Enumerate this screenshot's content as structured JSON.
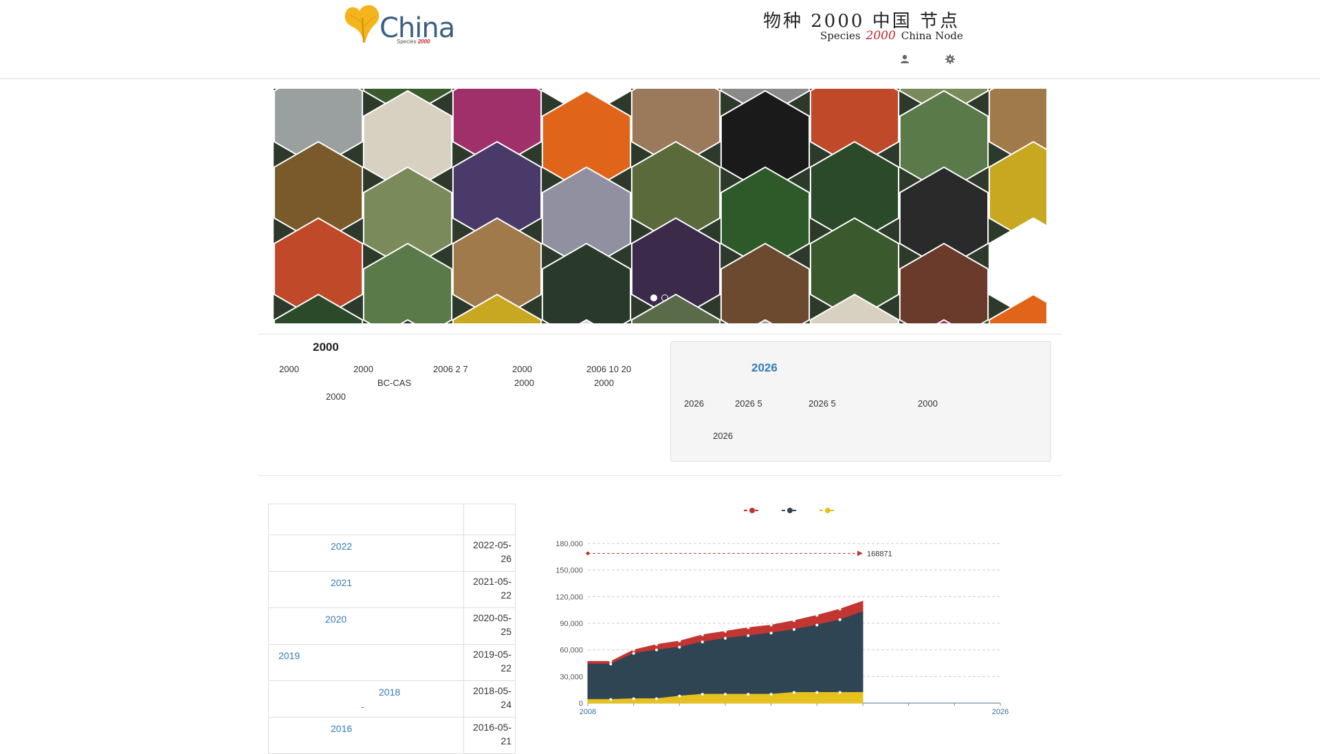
{
  "header": {
    "logo_word": "China",
    "logo_sub_prefix": "Species",
    "logo_sub_mark": "2000",
    "title": "物种 2000 中国 节点",
    "subtitle_left": "Species",
    "subtitle_mark": "2000",
    "subtitle_right": "China Node",
    "icons": [
      "user-icon",
      "gear-icon"
    ]
  },
  "banner": {
    "slide_count": 2,
    "active_slide": 1
  },
  "intro": {
    "title": "2000",
    "line1": [
      "2000",
      "2000",
      "2006  2  7",
      "2000",
      "2006  10  20"
    ],
    "line2": [
      "BC-CAS",
      "2000",
      "2000"
    ],
    "line3": [
      "2000"
    ]
  },
  "notice": {
    "title": "2026",
    "row1": [
      "2026",
      "2026  5",
      "2026  5",
      "2000"
    ],
    "row2": [
      "2026"
    ]
  },
  "news": {
    "rows": [
      {
        "title": "2022",
        "date": "2022-05-26"
      },
      {
        "title": "2021",
        "date": "2021-05-22"
      },
      {
        "title": "2020",
        "date": "2020-05-25"
      },
      {
        "title": "2019",
        "date": "2019-05-22"
      },
      {
        "title": "2018",
        "date": "2018-05-24",
        "extra": "-"
      },
      {
        "title": "2016",
        "date": "2016-05-21"
      }
    ]
  },
  "chart_data": {
    "type": "area",
    "colors": [
      "#c23531",
      "#2f4554",
      "#e6c11e"
    ],
    "legend_position": "top-center",
    "x": [
      2008,
      2009,
      2010,
      2011,
      2012,
      2013,
      2014,
      2015,
      2016,
      2017,
      2018,
      2019,
      2020
    ],
    "xlim": [
      2008,
      2026
    ],
    "x_tick_labels": [
      "2008",
      "2026"
    ],
    "ylim": [
      0,
      180000
    ],
    "y_ticks": [
      "0",
      "30,000",
      "60,000",
      "90,000",
      "120,000",
      "150,000",
      "180,000"
    ],
    "grid": true,
    "series": [
      {
        "values": [
          47000,
          47000,
          60000,
          66000,
          70000,
          77000,
          81000,
          85000,
          88000,
          93000,
          99000,
          106000,
          115000
        ]
      },
      {
        "values": [
          44000,
          44000,
          56000,
          60000,
          63000,
          69000,
          73000,
          76000,
          79000,
          83000,
          88000,
          94000,
          103000
        ]
      },
      {
        "values": [
          4000,
          4000,
          5000,
          5000,
          8000,
          10000,
          10000,
          10000,
          10000,
          12000,
          12000,
          12000,
          12000
        ]
      }
    ],
    "markline": {
      "value": 168871,
      "label": "168871"
    }
  }
}
